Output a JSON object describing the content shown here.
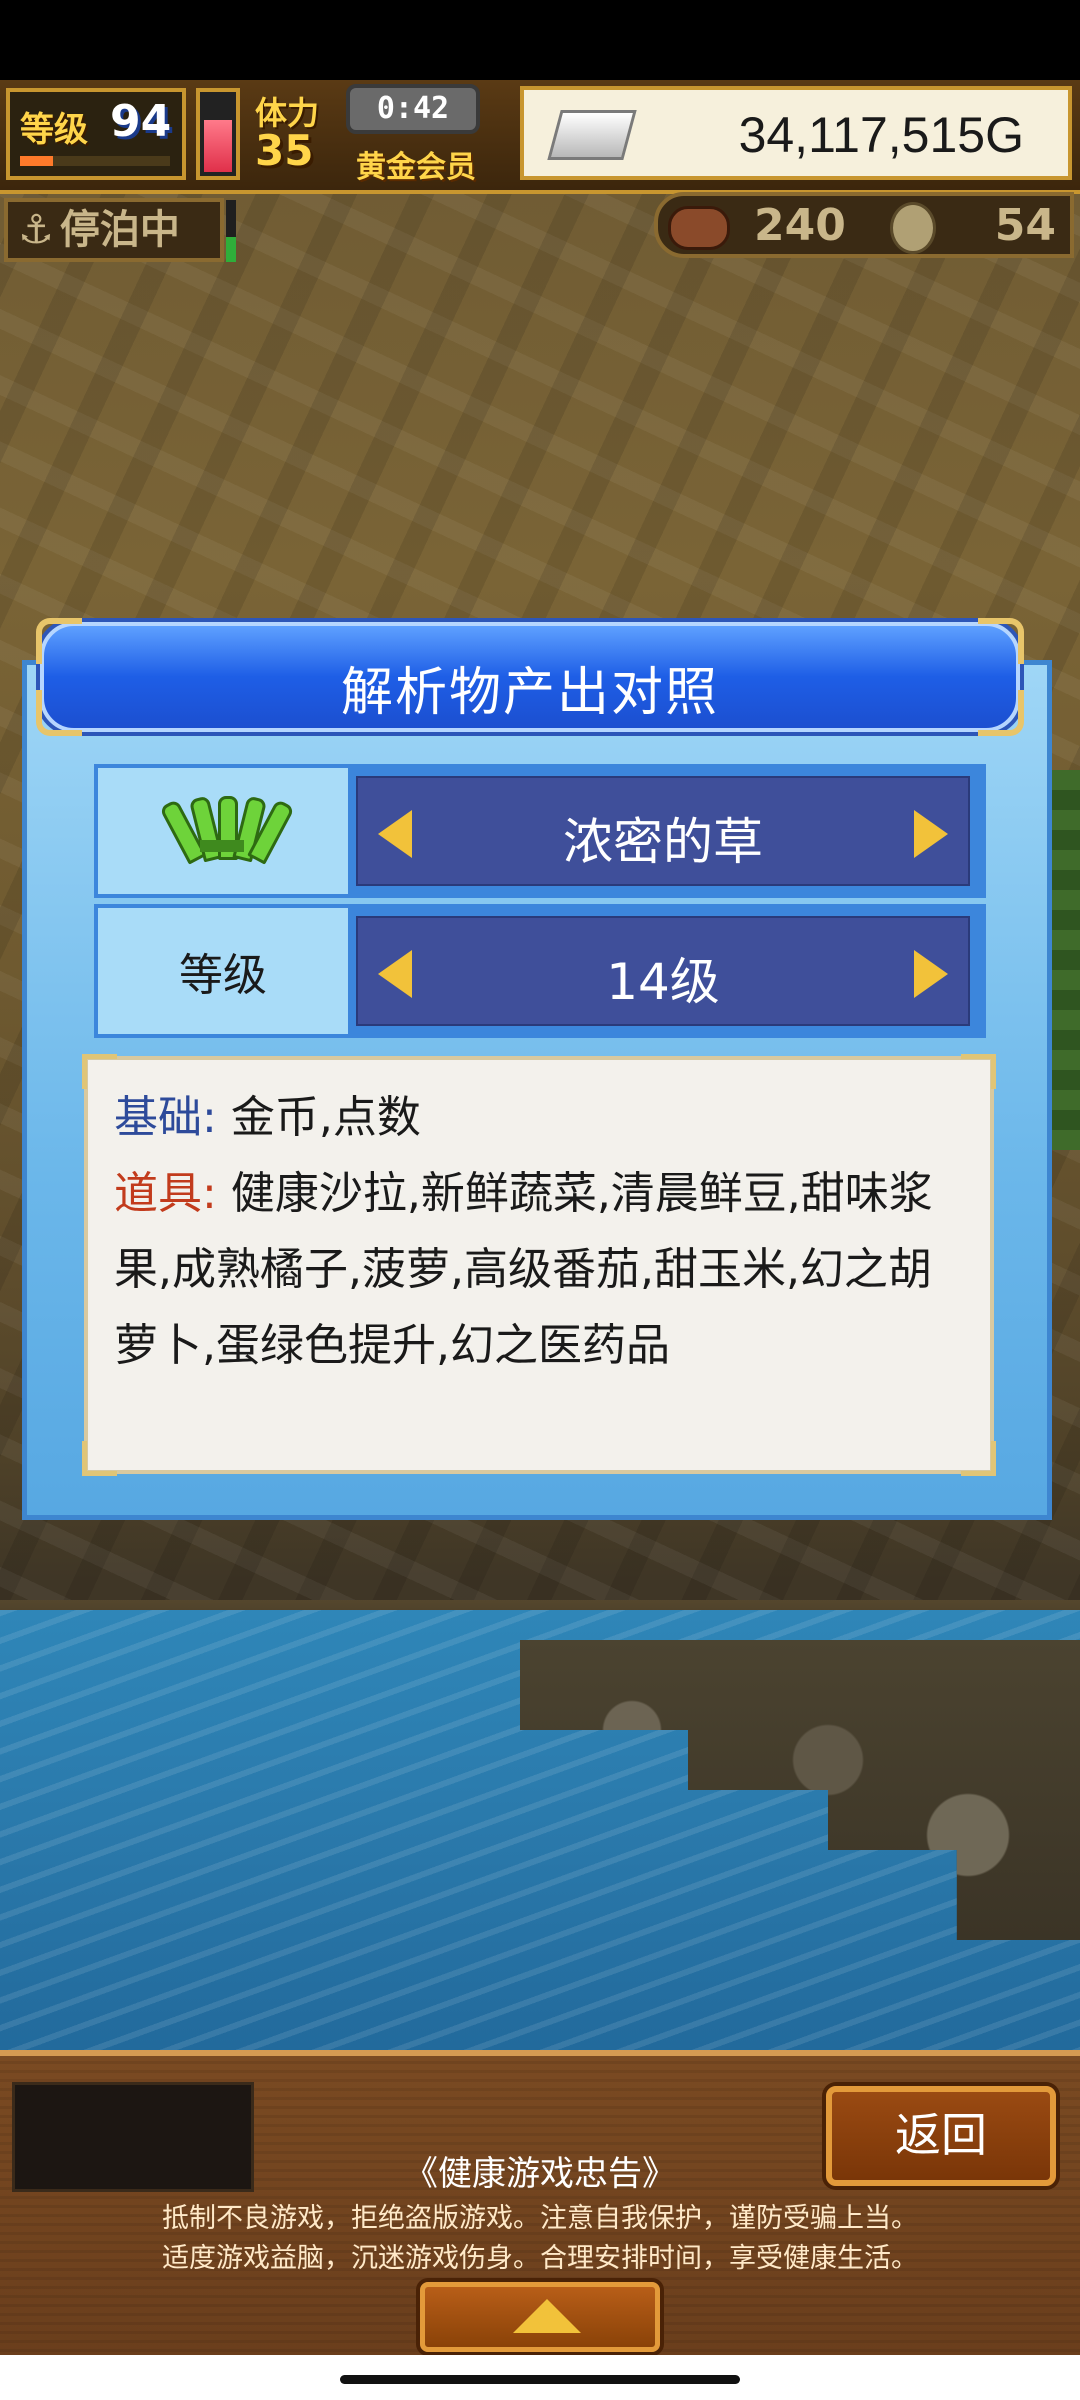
{
  "hud": {
    "level_label": "等级",
    "level": "94",
    "stamina_label": "体力",
    "stamina": "35",
    "timer": "0:42",
    "membership": "黄金会员",
    "gold": "34,117,515G"
  },
  "status": {
    "moored_label": "停泊中",
    "resource1": "240",
    "resource2": "54"
  },
  "dialog": {
    "title": "解析物产出对照",
    "item_name": "浓密的草",
    "level_label": "等级",
    "level_value": "14级",
    "base_label": "基础:",
    "base_value": "金币,点数",
    "items_label": "道具:",
    "items_value": "健康沙拉,新鲜蔬菜,清晨鲜豆,甜味浆果,成熟橘子,菠萝,高级番茄,甜玉米,幻之胡萝卜,蛋绿色提升,幻之医药品"
  },
  "bottom": {
    "back_label": "返回",
    "notice_title": "《健康游戏忠告》",
    "notice_line1": "抵制不良游戏，拒绝盗版游戏。注意自我保护，谨防受骗上当。",
    "notice_line2": "适度游戏益脑，沉迷游戏伤身。合理安排时间，享受健康生活。"
  },
  "colors": {
    "dialog_header": "#1e5ee6",
    "arrow": "#f2c23a",
    "items_label": "#c23b1c",
    "base_label": "#2d4a9a"
  }
}
